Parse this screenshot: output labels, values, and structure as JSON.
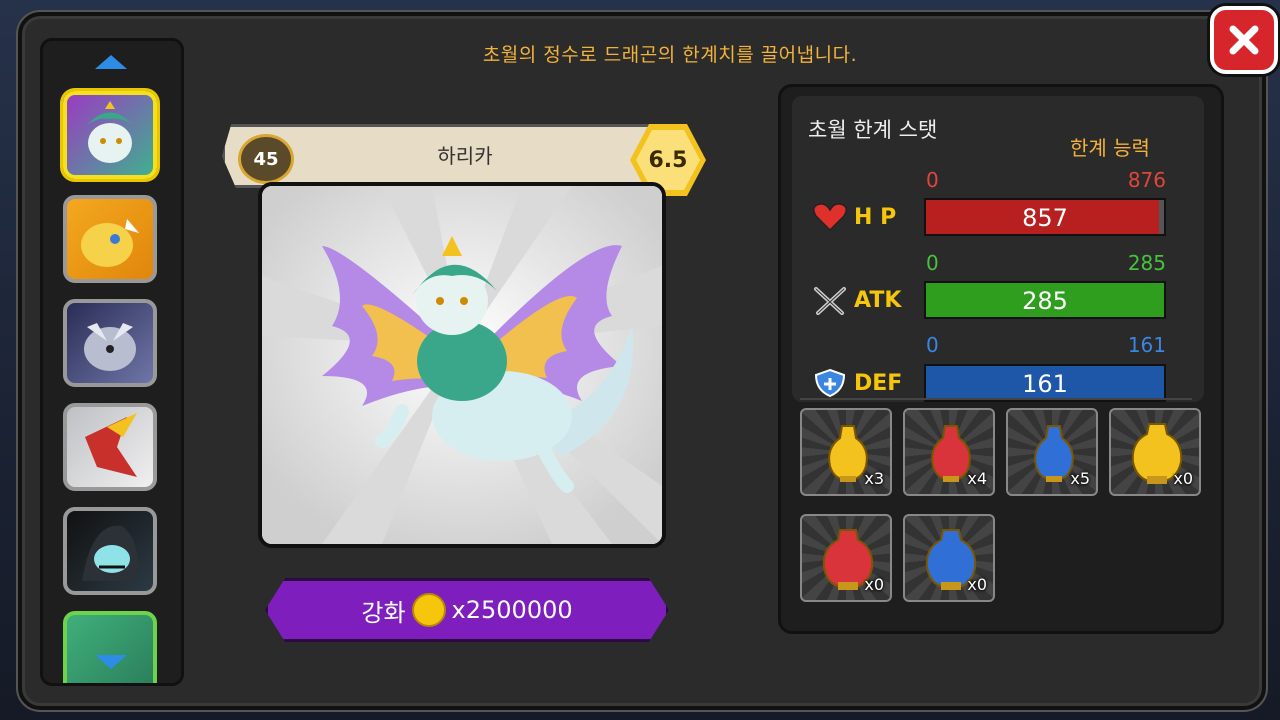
{
  "header": {
    "subtitle": "초월의 정수로 드래곤의 한계치를 끌어냅니다."
  },
  "dragon_card": {
    "level": "45",
    "name": "하리카",
    "grade": "6.5"
  },
  "upgrade_button": {
    "label": "강화",
    "cost": "x2500000"
  },
  "stats_panel": {
    "title": "초월 한계 스탯",
    "limit_label": "한계 능력",
    "stats": [
      {
        "label": "H P",
        "min": "0",
        "max": "876",
        "value": "857",
        "fill": 0.978,
        "color": "#b81f1f",
        "max_color": "#e0463b"
      },
      {
        "label": "ATK",
        "min": "0",
        "max": "285",
        "value": "285",
        "fill": 1.0,
        "color": "#2f9e1e",
        "max_color": "#48c23a"
      },
      {
        "label": "DEF",
        "min": "0",
        "max": "161",
        "value": "161",
        "fill": 1.0,
        "color": "#1f57a8",
        "max_color": "#3a86e0"
      }
    ]
  },
  "items": [
    {
      "count": "x3",
      "color": "#f4c21f",
      "icon": "yellow-potion-icon"
    },
    {
      "count": "x4",
      "color": "#d9343b",
      "icon": "red-potion-icon"
    },
    {
      "count": "x5",
      "color": "#2f6fd6",
      "icon": "blue-potion-icon"
    },
    {
      "count": "x0",
      "color": "#f4c21f",
      "icon": "large-yellow-potion-icon"
    },
    {
      "count": "x0",
      "color": "#d9343b",
      "icon": "large-red-potion-icon"
    },
    {
      "count": "x0",
      "color": "#2f6fd6",
      "icon": "large-blue-potion-icon"
    }
  ]
}
